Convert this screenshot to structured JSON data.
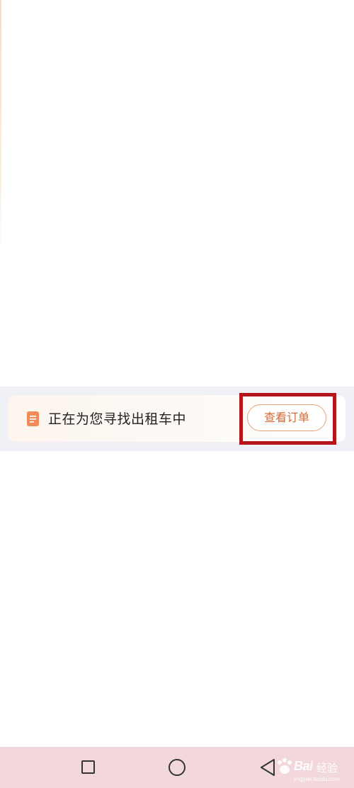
{
  "status_bar": {
    "message": "正在为您寻找出租车中",
    "icon": "order-document-icon",
    "action_label": "查看订单",
    "action_color": "#d26a35",
    "highlight_color": "#b5141b"
  },
  "nav_bar": {
    "recent_icon": "square-recents-icon",
    "home_icon": "circle-home-icon",
    "back_icon": "triangle-back-icon",
    "background": "#f2d8dc"
  },
  "watermark": {
    "text": "Bai",
    "sub": "经验",
    "url": "jingyan.baidu.com"
  }
}
